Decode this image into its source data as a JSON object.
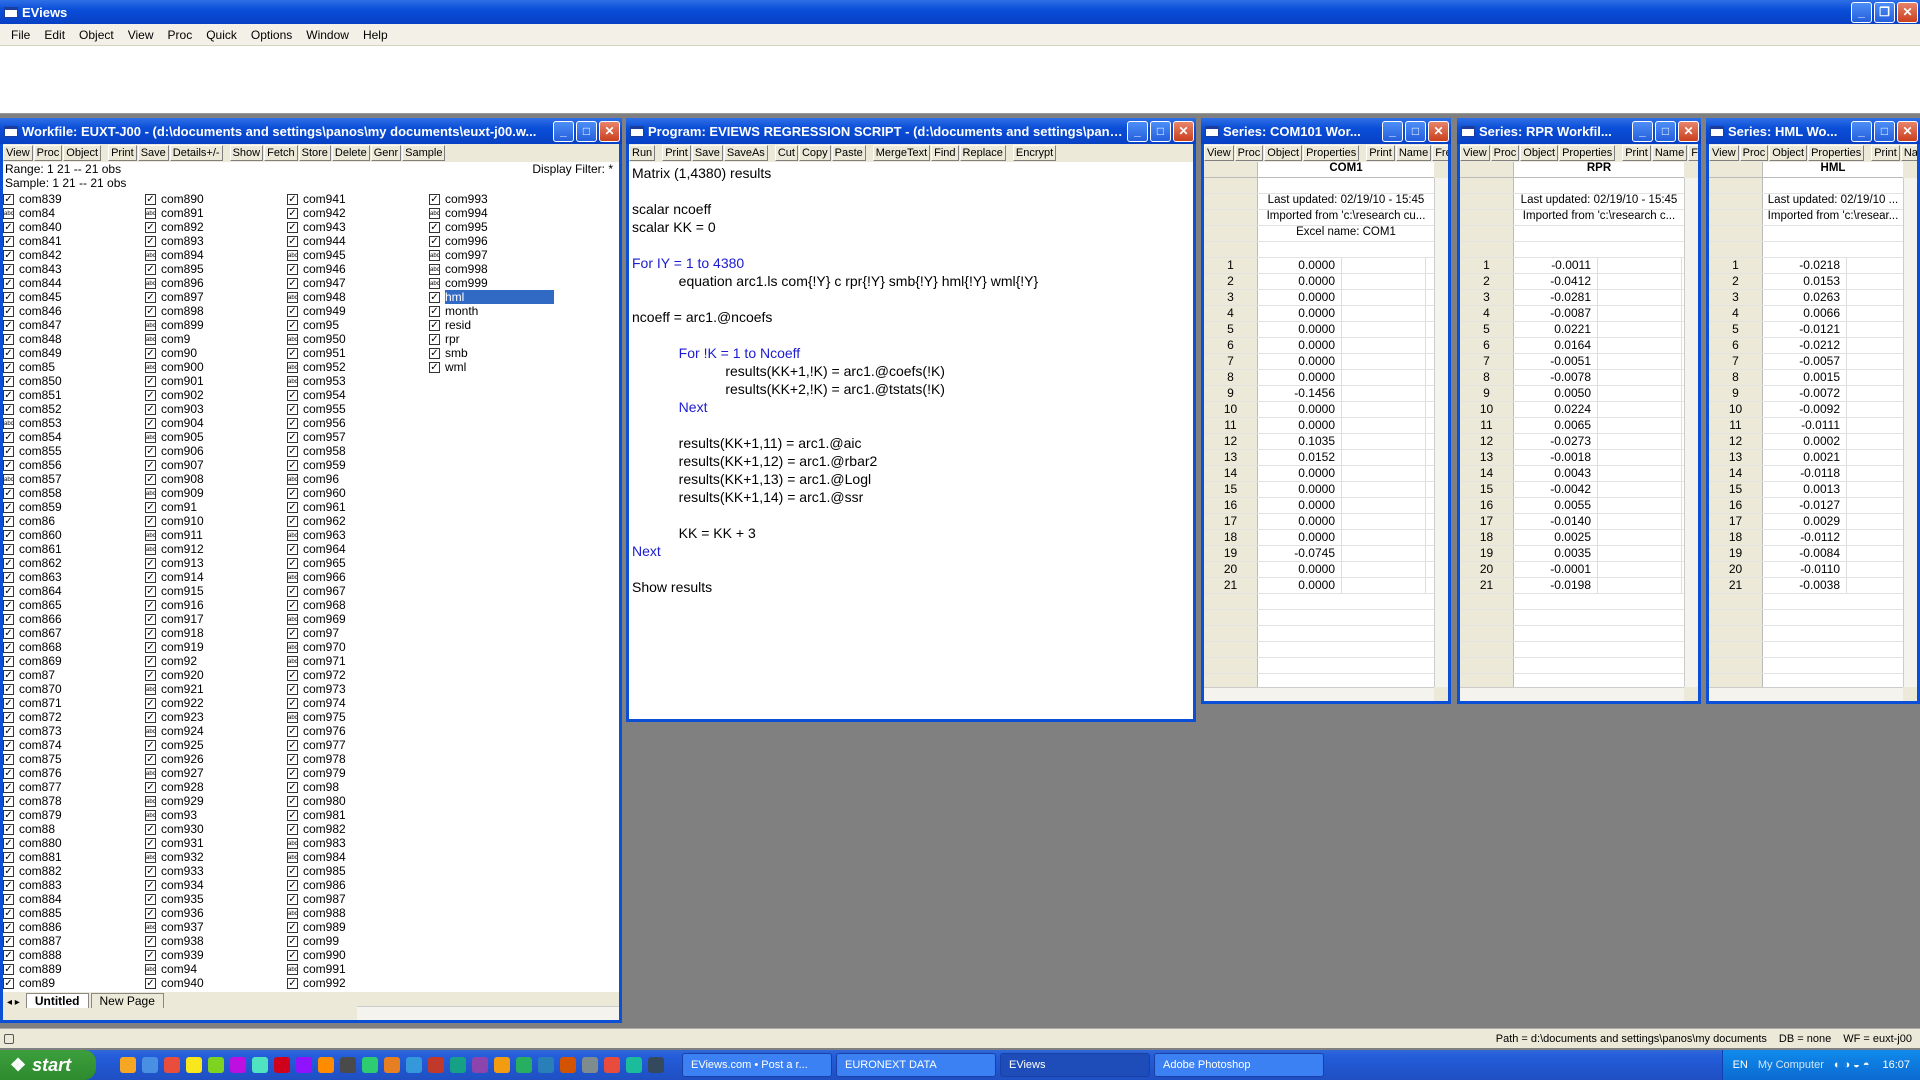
{
  "app": {
    "title": "EViews"
  },
  "menu": [
    "File",
    "Edit",
    "Object",
    "View",
    "Proc",
    "Quick",
    "Options",
    "Window",
    "Help"
  ],
  "workfile": {
    "title": "Workfile: EUXT-J00 - (d:\\documents and settings\\panos\\my documents\\euxt-j00.w...",
    "toolbar": [
      "View",
      "Proc",
      "Object",
      "Print",
      "Save",
      "Details+/-",
      "Show",
      "Fetch",
      "Store",
      "Delete",
      "Genr",
      "Sample"
    ],
    "range": "Range:  1 21   --   21 obs",
    "sample": "Sample: 1 21   --   21 obs",
    "filter": "Display Filter: *",
    "columns": [
      [
        "com839",
        "com84",
        "com840",
        "com841",
        "com842",
        "com843",
        "com844",
        "com845",
        "com846",
        "com847",
        "com848",
        "com849",
        "com85",
        "com850",
        "com851",
        "com852",
        "com853",
        "com854",
        "com855",
        "com856",
        "com857",
        "com858",
        "com859",
        "com86",
        "com860",
        "com861",
        "com862",
        "com863",
        "com864",
        "com865",
        "com866",
        "com867",
        "com868",
        "com869",
        "com87",
        "com870",
        "com871",
        "com872",
        "com873",
        "com874",
        "com875",
        "com876",
        "com877",
        "com878",
        "com879",
        "com88",
        "com880",
        "com881",
        "com882",
        "com883",
        "com884",
        "com885",
        "com886",
        "com887",
        "com888",
        "com889",
        "com89"
      ],
      [
        "com890",
        "com891",
        "com892",
        "com893",
        "com894",
        "com895",
        "com896",
        "com897",
        "com898",
        "com899",
        "com9",
        "com90",
        "com900",
        "com901",
        "com902",
        "com903",
        "com904",
        "com905",
        "com906",
        "com907",
        "com908",
        "com909",
        "com91",
        "com910",
        "com911",
        "com912",
        "com913",
        "com914",
        "com915",
        "com916",
        "com917",
        "com918",
        "com919",
        "com92",
        "com920",
        "com921",
        "com922",
        "com923",
        "com924",
        "com925",
        "com926",
        "com927",
        "com928",
        "com929",
        "com93",
        "com930",
        "com931",
        "com932",
        "com933",
        "com934",
        "com935",
        "com936",
        "com937",
        "com938",
        "com939",
        "com94",
        "com940"
      ],
      [
        "com941",
        "com942",
        "com943",
        "com944",
        "com945",
        "com946",
        "com947",
        "com948",
        "com949",
        "com95",
        "com950",
        "com951",
        "com952",
        "com953",
        "com954",
        "com955",
        "com956",
        "com957",
        "com958",
        "com959",
        "com96",
        "com960",
        "com961",
        "com962",
        "com963",
        "com964",
        "com965",
        "com966",
        "com967",
        "com968",
        "com969",
        "com97",
        "com970",
        "com971",
        "com972",
        "com973",
        "com974",
        "com975",
        "com976",
        "com977",
        "com978",
        "com979",
        "com98",
        "com980",
        "com981",
        "com982",
        "com983",
        "com984",
        "com985",
        "com986",
        "com987",
        "com988",
        "com989",
        "com99",
        "com990",
        "com991",
        "com992"
      ],
      [
        "com993",
        "com994",
        "com995",
        "com996",
        "com997",
        "com998",
        "com999",
        "hml",
        "month",
        "resid",
        "rpr",
        "smb",
        "wml"
      ]
    ],
    "selected": "hml",
    "tabs": [
      "Untitled",
      "New Page"
    ]
  },
  "program": {
    "title": "Program: EVIEWS REGRESSION SCRIPT - (d:\\documents and settings\\panos...",
    "toolbar": [
      "Run",
      "Print",
      "Save",
      "SaveAs",
      "Cut",
      "Copy",
      "Paste",
      "MergeText",
      "Find",
      "Replace",
      "Encrypt"
    ],
    "lines": [
      "Matrix (1,4380) results",
      "",
      "scalar ncoeff",
      "scalar KK = 0",
      "",
      "For IY = 1 to 4380",
      "            equation arc1.ls com{!Y} c rpr{!Y} smb{!Y} hml{!Y} wml{!Y}",
      "",
      "ncoeff = arc1.@ncoefs",
      "",
      "            For !K = 1 to Ncoeff",
      "                        results(KK+1,!K) = arc1.@coefs(!K)",
      "                        results(KK+2,!K) = arc1.@tstats(!K)",
      "            Next",
      "",
      "            results(KK+1,11) = arc1.@aic",
      "            results(KK+1,12) = arc1.@rbar2",
      "            results(KK+1,13) = arc1.@Logl",
      "            results(KK+1,14) = arc1.@ssr",
      "",
      "            KK = KK + 3",
      "Next",
      "",
      "Show results"
    ]
  },
  "series": [
    {
      "title": "Series: COM101   Wor...",
      "toolbar": [
        "View",
        "Proc",
        "Object",
        "Properties",
        "Print",
        "Name",
        "Freez"
      ],
      "header": "COM1",
      "meta": [
        "Last updated: 02/19/10 - 15:45",
        "Imported from 'c:\\research cu...",
        "Excel name: COM1"
      ],
      "values": [
        "0.0000",
        "0.0000",
        "0.0000",
        "0.0000",
        "0.0000",
        "0.0000",
        "0.0000",
        "0.0000",
        "-0.1456",
        "0.0000",
        "0.0000",
        "0.1035",
        "0.0152",
        "0.0000",
        "0.0000",
        "0.0000",
        "0.0000",
        "0.0000",
        "-0.0745",
        "0.0000",
        "0.0000"
      ]
    },
    {
      "title": "Series: RPR   Workfil...",
      "toolbar": [
        "View",
        "Proc",
        "Object",
        "Properties",
        "Print",
        "Name",
        "Fre"
      ],
      "header": "RPR",
      "meta": [
        "Last updated: 02/19/10 - 15:45",
        "Imported from 'c:\\research c..."
      ],
      "values": [
        "-0.0011",
        "-0.0412",
        "-0.0281",
        "-0.0087",
        "0.0221",
        "0.0164",
        "-0.0051",
        "-0.0078",
        "0.0050",
        "0.0224",
        "0.0065",
        "-0.0273",
        "-0.0018",
        "0.0043",
        "-0.0042",
        "0.0055",
        "-0.0140",
        "0.0025",
        "0.0035",
        "-0.0001",
        "-0.0198"
      ]
    },
    {
      "title": "Series: HML   Wo...",
      "toolbar": [
        "View",
        "Proc",
        "Object",
        "Properties",
        "Print",
        "Name"
      ],
      "header": "HML",
      "meta": [
        "Last updated: 02/19/10 ...",
        "Imported from 'c:\\resear..."
      ],
      "values": [
        "-0.0218",
        "0.0153",
        "0.0263",
        "0.0066",
        "-0.0121",
        "-0.0212",
        "-0.0057",
        "0.0015",
        "-0.0072",
        "-0.0092",
        "-0.0111",
        "0.0002",
        "0.0021",
        "-0.0118",
        "0.0013",
        "-0.0127",
        "0.0029",
        "-0.0112",
        "-0.0084",
        "-0.0110",
        "-0.0038"
      ]
    }
  ],
  "status": {
    "path": "Path = d:\\documents and settings\\panos\\my documents",
    "db": "DB = none",
    "wf": "WF = euxt-j00"
  },
  "taskbar": {
    "start": "start",
    "tasks": [
      "EViews.com • Post a r...",
      "EURONEXT DATA",
      "EViews",
      "Adobe Photoshop"
    ],
    "lang": "EN",
    "mycomputer": "My Computer",
    "clock": "16:07"
  }
}
